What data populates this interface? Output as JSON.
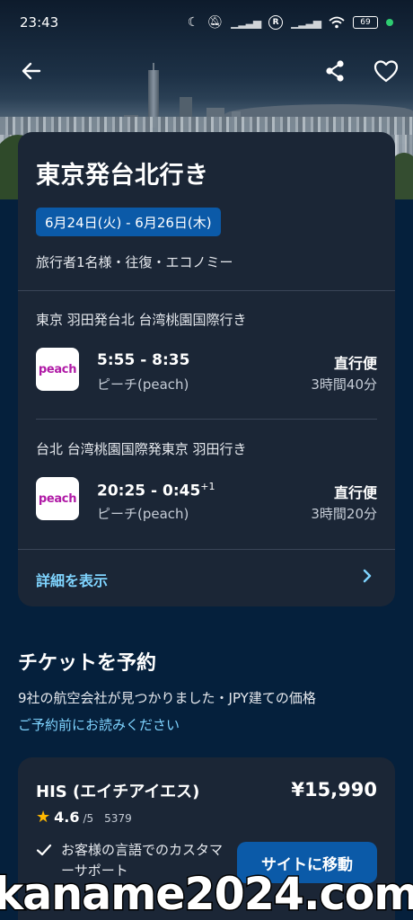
{
  "status_bar": {
    "time": "23:43",
    "battery": "69"
  },
  "nav": {
    "back_icon": "back-arrow-icon",
    "share_icon": "share-icon",
    "favorite_icon": "heart-icon"
  },
  "trip": {
    "title": "東京発台北行き",
    "dates": "6月24日(火) - 6月26日(木)",
    "travellers": "旅行者1名様・往復・エコノミー",
    "legs": [
      {
        "route": "東京 羽田発台北 台湾桃園国際行き",
        "logo_text": "peach",
        "times": "5:55 - 8:35",
        "day_offset": "",
        "airline": "ピーチ(peach)",
        "stops": "直行便",
        "duration": "3時間40分"
      },
      {
        "route": "台北 台湾桃園国際発東京 羽田行き",
        "logo_text": "peach",
        "times": "20:25 - 0:45",
        "day_offset": "+1",
        "airline": "ピーチ(peach)",
        "stops": "直行便",
        "duration": "3時間20分"
      }
    ],
    "details_link": "詳細を表示"
  },
  "booking": {
    "title": "チケットを予約",
    "subtitle": "9社の航空会社が見つかりました・JPY建ての価格",
    "notice_link": "ご予約前にお読みください",
    "offers": [
      {
        "provider": "HIS (エイチアイエス)",
        "price": "¥15,990",
        "rating": "4.6",
        "rating_max": "/5",
        "reviews": "5379",
        "feature": "お客様の言語でのカスタマーサポート",
        "button": "サイトに移動"
      }
    ]
  },
  "colors": {
    "background": "#05203c",
    "card": "#1b2636",
    "accent_button": "#0b5aa8",
    "link": "#7fd4ff",
    "star": "#ffb800"
  },
  "watermark": "kaname2024.com"
}
